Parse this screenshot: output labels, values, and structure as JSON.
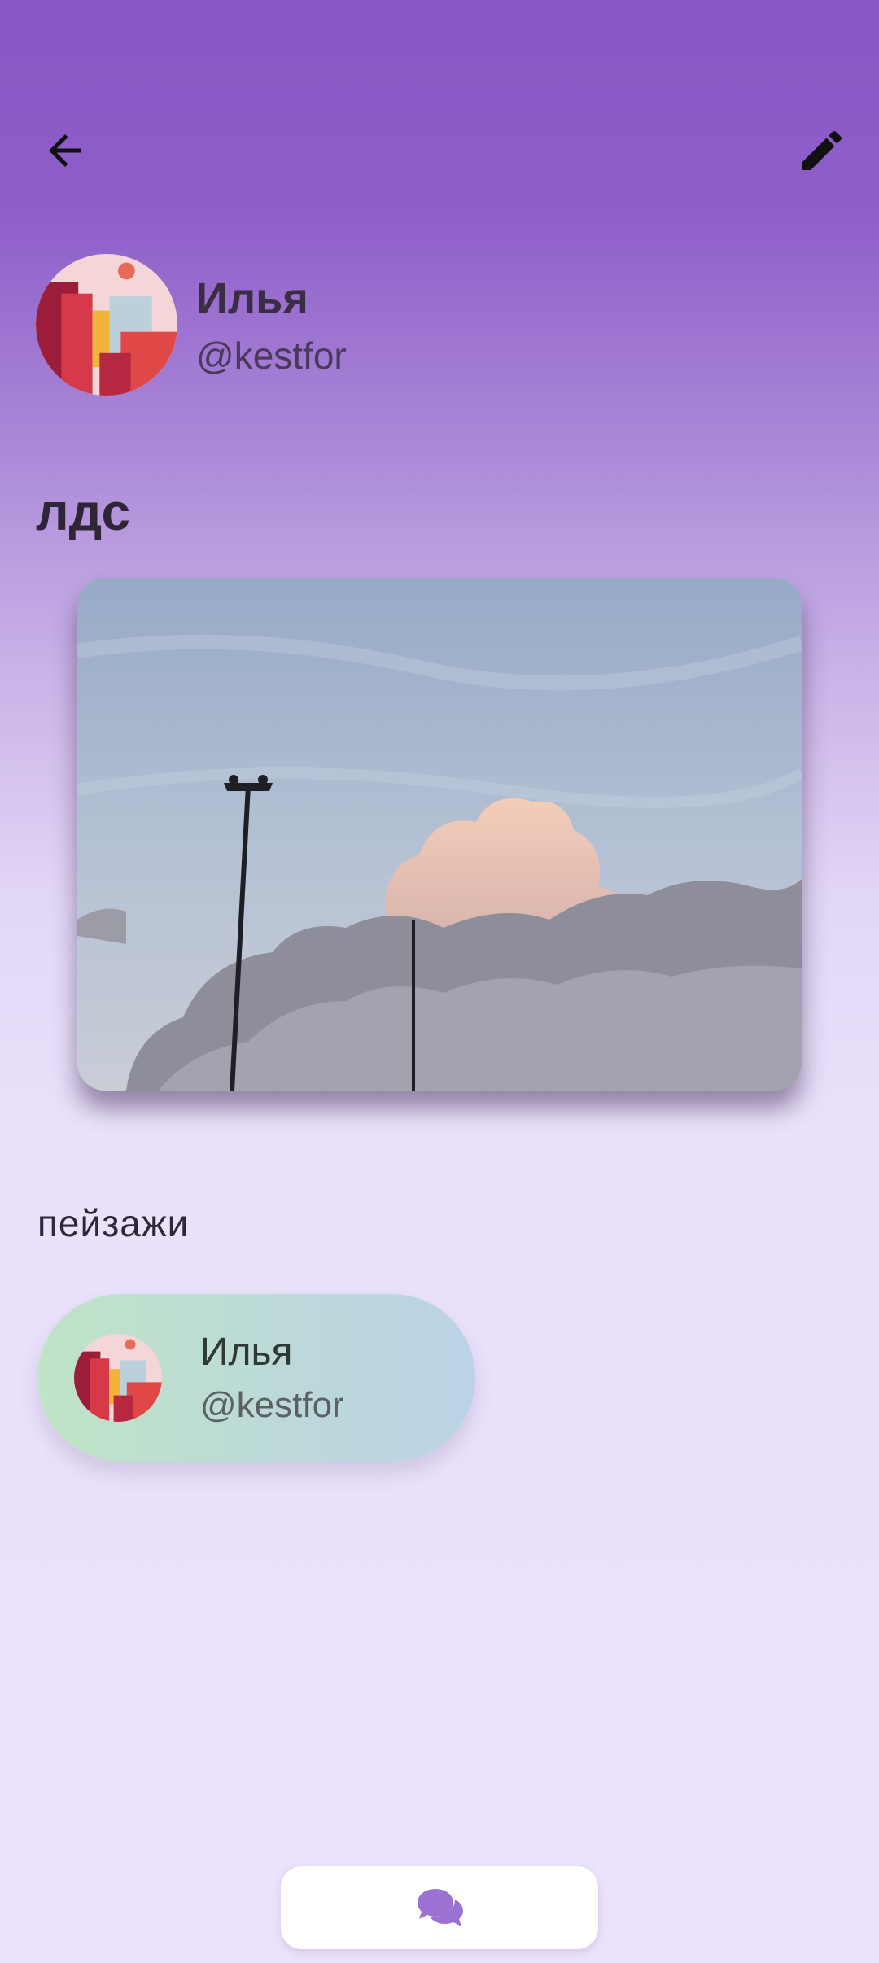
{
  "header": {
    "back_icon": "arrow-left-icon",
    "edit_icon": "pencil-icon"
  },
  "profile": {
    "name": "Илья",
    "handle": "@kestfor"
  },
  "post": {
    "title": "лдс",
    "caption": "пейзажи"
  },
  "author": {
    "name": "Илья",
    "handle": "@kestfor"
  },
  "bottom": {
    "chat_icon": "chat-bubbles-icon",
    "accent": "#9b72d2"
  }
}
